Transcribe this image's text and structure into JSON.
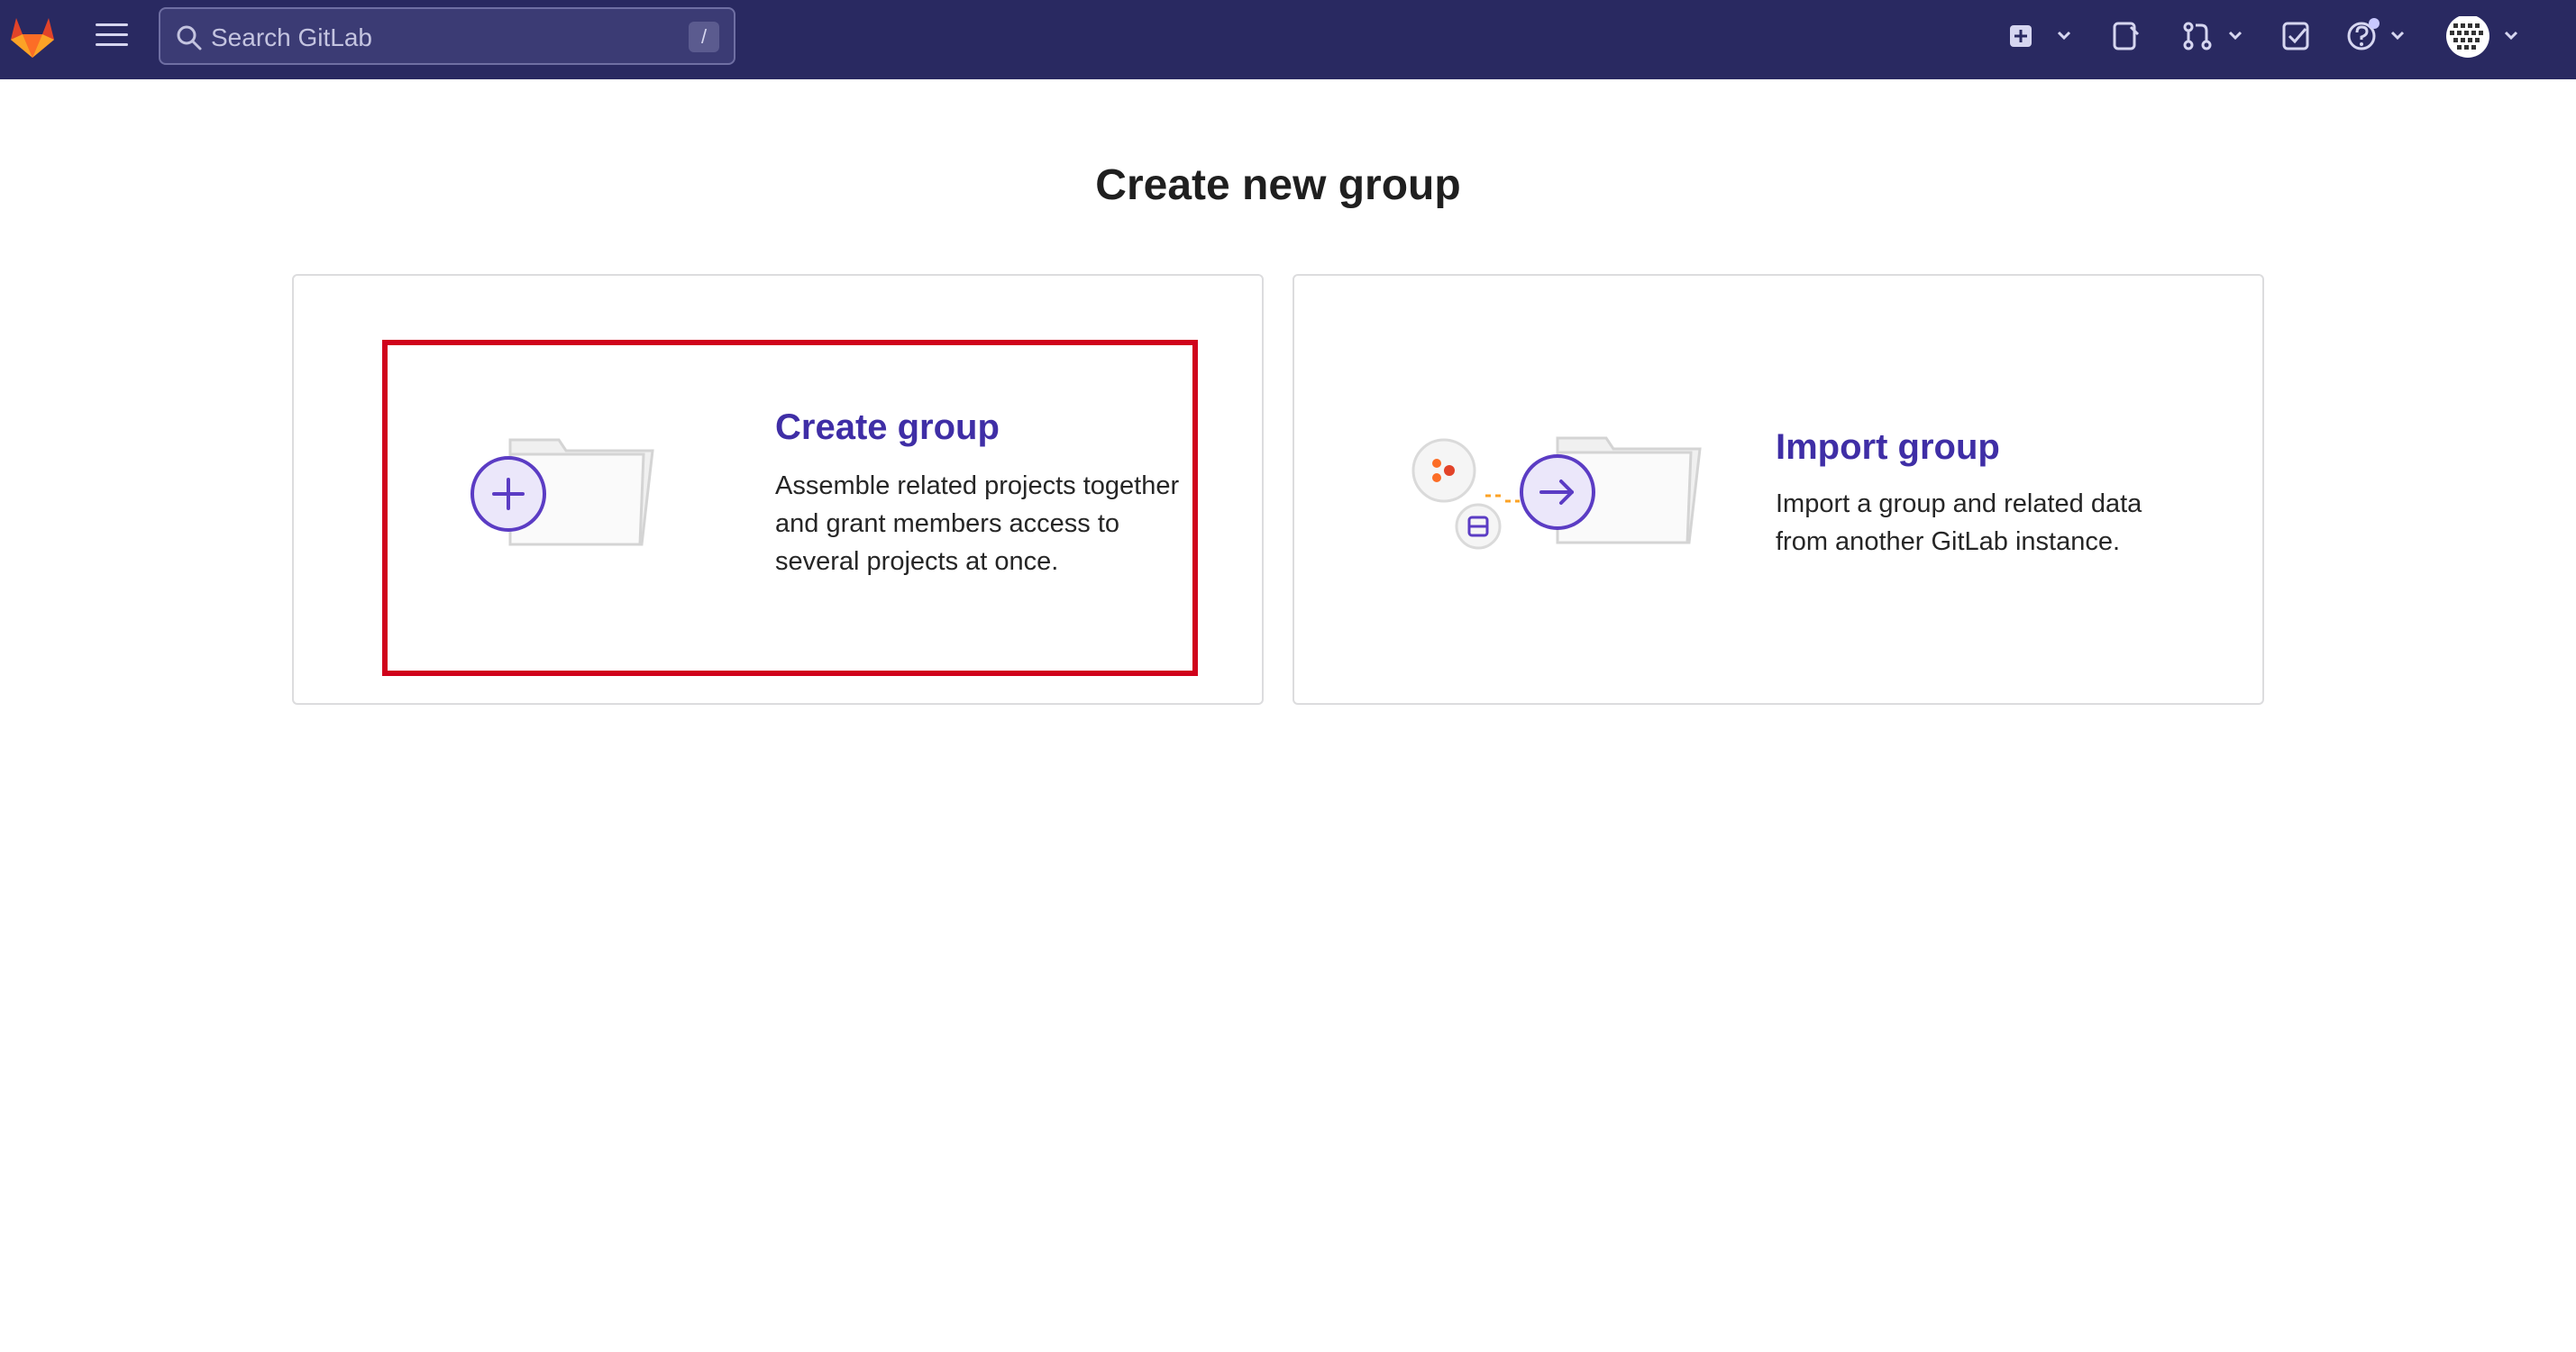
{
  "header": {
    "search_placeholder": "Search GitLab",
    "search_shortcut": "/"
  },
  "icons": {
    "logo": "gitlab-tanuki-logo",
    "menu": "hamburger-menu-icon",
    "search": "search-icon",
    "new": "plus-square-icon",
    "issues": "issues-icon",
    "merge_requests": "merge-request-icon",
    "todos": "todo-checkbox-icon",
    "help": "help-icon",
    "avatar": "user-avatar"
  },
  "main": {
    "title": "Create new group",
    "cards": [
      {
        "title": "Create group",
        "desc_lines": [
          "Assemble related projects together",
          "and grant members access to",
          "several projects at once."
        ]
      },
      {
        "title": "Import group",
        "desc_lines": [
          "Import a group and related data",
          "from another GitLab instance."
        ]
      }
    ]
  },
  "colors": {
    "topbar": "#292961",
    "accent": "#3f2ea6",
    "highlight": "#d0021b",
    "gitlab_orange": "#fc6d26"
  }
}
